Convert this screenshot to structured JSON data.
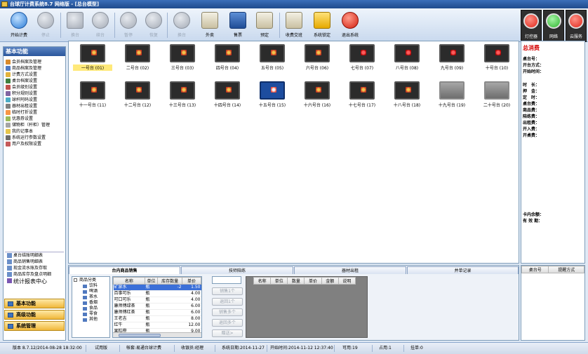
{
  "window": {
    "title": "台球厅计费系统8.7 网络版 - [总台模型]"
  },
  "toolbar": {
    "buttons": [
      {
        "label": "开始计费",
        "icon": "play-icon",
        "enabled": true
      },
      {
        "label": "停止",
        "icon": "stop-icon",
        "enabled": false
      },
      {
        "label": "换台",
        "icon": "swap-table-icon",
        "enabled": false
      },
      {
        "label": "续台",
        "icon": "clock-icon",
        "enabled": false
      },
      {
        "label": "暂停",
        "icon": "pause-icon",
        "enabled": false
      },
      {
        "label": "恢复",
        "icon": "check-icon",
        "enabled": false
      },
      {
        "label": "换台",
        "icon": "refresh-icon",
        "enabled": false
      },
      {
        "label": "外卖",
        "icon": "takeout-icon",
        "enabled": true
      },
      {
        "label": "售票",
        "icon": "ticket-icon",
        "enabled": true
      },
      {
        "label": "预定",
        "icon": "calendar-icon",
        "enabled": true
      },
      {
        "label": "收费交班",
        "icon": "cash-icon",
        "enabled": true
      },
      {
        "label": "系统锁定",
        "icon": "lock-icon",
        "enabled": true
      },
      {
        "label": "退出系统",
        "icon": "exit-icon",
        "enabled": true
      }
    ],
    "signals": [
      {
        "label": "灯控器",
        "color": "#e0261a"
      },
      {
        "label": "网络",
        "color": "#2fb52f"
      },
      {
        "label": "云服务",
        "color": "#e0261a"
      }
    ]
  },
  "sidebar": {
    "header": "基本功能",
    "items": [
      "会员档案及管理",
      "商品档案及管理",
      "计费方式设置",
      "桌台档案设置",
      "会员级别设置",
      "积分规则设置",
      "球杆阿码设置",
      "器材出租设置",
      "临时打折设置",
      "优惠券设置",
      "储物柜（杆柜）管理",
      "我的记事本",
      "系统运行参数设置",
      "用户及权限设置"
    ],
    "reports": [
      "桌台结账明细表",
      "商品销售明细表",
      "现金流水账及存取",
      "商品库存及盘点明细"
    ],
    "report_center": "统计报表中心",
    "nav": [
      "基本功能",
      "高级功能",
      "系统管理"
    ]
  },
  "tables": [
    {
      "name": "一号台 (01)",
      "state": "idle",
      "selected": true
    },
    {
      "name": "二号台 (02)",
      "state": "idle"
    },
    {
      "name": "三号台 (03)",
      "state": "idle"
    },
    {
      "name": "四号台 (04)",
      "state": "idle"
    },
    {
      "name": "五号台 (05)",
      "state": "idle"
    },
    {
      "name": "六号台 (06)",
      "state": "idle"
    },
    {
      "name": "七号台 (07)",
      "state": "inuse"
    },
    {
      "name": "八号台 (08)",
      "state": "inuse"
    },
    {
      "name": "九号台 (09)",
      "state": "inuse"
    },
    {
      "name": "十号台 (10)",
      "state": "inuse"
    },
    {
      "name": "十一号台 (11)",
      "state": "idle"
    },
    {
      "name": "十二号台 (12)",
      "state": "idle"
    },
    {
      "name": "十三号台 (13)",
      "state": "idle"
    },
    {
      "name": "十四号台 (14)",
      "state": "idle"
    },
    {
      "name": "十五号台 (15)",
      "state": "blue"
    },
    {
      "name": "十六号台 (16)",
      "state": "idle"
    },
    {
      "name": "十七号台 (17)",
      "state": "idle"
    },
    {
      "name": "十八号台 (18)",
      "state": "idle"
    },
    {
      "name": "十九号台 (19)",
      "state": "off"
    },
    {
      "name": "二十号台 (20)",
      "state": "off"
    }
  ],
  "info": {
    "total_label": "总消费",
    "fields_top": [
      "桌台号：",
      "开台方式：",
      "开始时间："
    ],
    "fields_mid": [
      "时　长：",
      "押　金：",
      "定　时：",
      "桌台费：",
      "商品费：",
      "陪练费：",
      "出租费：",
      "开入费：",
      "开桌费："
    ],
    "fields_bottom": [
      "卡内余额：",
      "有 效 期："
    ]
  },
  "bottom": {
    "tabs": [
      "台内商品销售",
      "技师陪练",
      "器材出租",
      "并单记录"
    ],
    "tree": {
      "root": "商品分类",
      "children": [
        "饮料",
        "啤酒",
        "茶水",
        "香烟",
        "食品",
        "零食",
        "其他"
      ]
    },
    "goods": {
      "headers": [
        "名称",
        "单位",
        "库存数量",
        "单价"
      ],
      "rows": [
        [
          "矿泉水",
          "瓶",
          "-2",
          "1.50"
        ],
        [
          "百事可乐",
          "瓶",
          "",
          "4.00"
        ],
        [
          "可口可乐",
          "瓶",
          "",
          "4.00"
        ],
        [
          "康师傅绿茶",
          "瓶",
          "",
          "6.00"
        ],
        [
          "康师傅红茶",
          "瓶",
          "",
          "6.00"
        ],
        [
          "王老吉",
          "瓶",
          "",
          "8.00"
        ],
        [
          "红牛",
          "瓶",
          "",
          "12.00"
        ],
        [
          "果粒橙",
          "瓶",
          "",
          "9.00"
        ]
      ]
    },
    "actions": [
      "销售1个",
      "退回1个",
      "销售多个",
      "退回多个",
      "赠送>"
    ],
    "sold_headers": [
      "名称",
      "单位",
      "数量",
      "单价",
      "金额",
      "说明"
    ],
    "right_headers": [
      "桌台号",
      "提醒方式"
    ]
  },
  "status": {
    "version": "版本 8.7.12/2014-08-28 18:32:00",
    "edition": "试用版",
    "account": "帐套:易通台球计费",
    "cashier": "收银员:经理",
    "system_date": "系统日期:2014-11-27",
    "start_time": "开始时间:2014-11-12 12:37:40",
    "available": "可用:19",
    "occupied": "占用:1",
    "pending": "挂单:0"
  }
}
